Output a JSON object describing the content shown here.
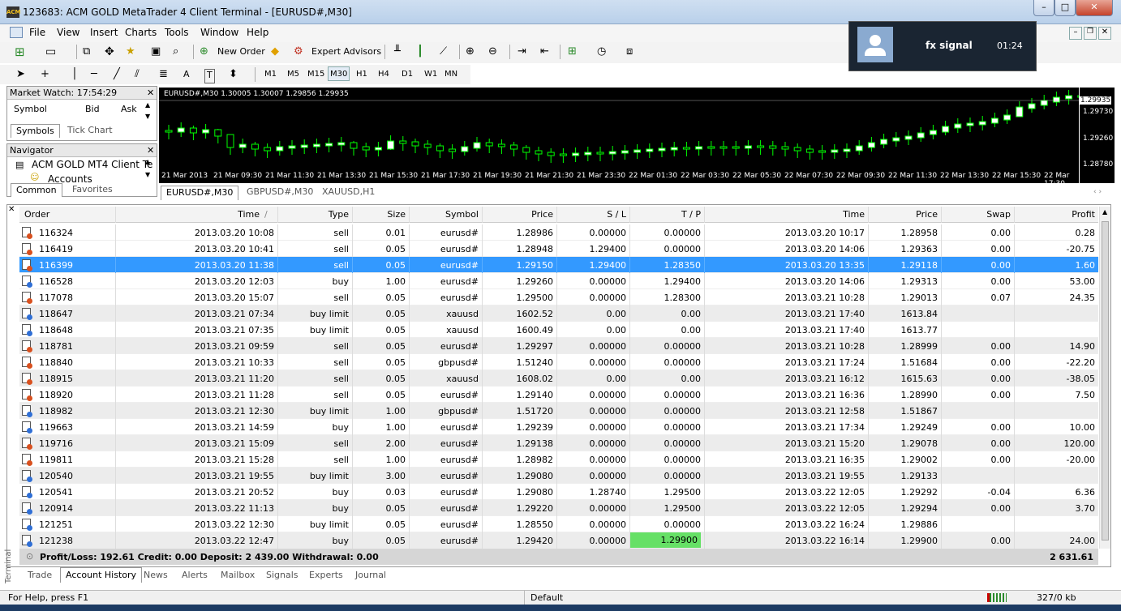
{
  "window": {
    "title": "123683: ACM GOLD MetaTrader 4 Client Terminal - [EURUSD#,M30]",
    "app_icon_text": "ACM"
  },
  "menu": [
    "File",
    "View",
    "Insert",
    "Charts",
    "Tools",
    "Window",
    "Help"
  ],
  "toolbar": {
    "new_order": "New Order",
    "expert_advisors": "Expert Advisors",
    "text_tool": "A",
    "textlabel_tool": "T"
  },
  "timeframes": [
    "M1",
    "M5",
    "M15",
    "M30",
    "H1",
    "H4",
    "D1",
    "W1",
    "MN"
  ],
  "market_watch": {
    "title": "Market Watch: 17:54:29",
    "col_symbol": "Symbol",
    "col_bid": "Bid",
    "col_ask": "Ask",
    "tab_symbols": "Symbols",
    "tab_tick_chart": "Tick Chart"
  },
  "navigator": {
    "title": "Navigator",
    "item_root": "ACM GOLD MT4 Client Te",
    "item_accounts": "Accounts",
    "tab_common": "Common",
    "tab_favorites": "Favorites"
  },
  "chart": {
    "header": "EURUSD#,M30  1.30005 1.30007 1.29856 1.29935",
    "price_labels": [
      "1.29935",
      "1.29730",
      "1.29260",
      "1.28780"
    ],
    "time_labels": [
      "21 Mar 2013",
      "21 Mar 09:30",
      "21 Mar 11:30",
      "21 Mar 13:30",
      "21 Mar 15:30",
      "21 Mar 17:30",
      "21 Mar 19:30",
      "21 Mar 21:30",
      "21 Mar 23:30",
      "22 Mar 01:30",
      "22 Mar 03:30",
      "22 Mar 05:30",
      "22 Mar 07:30",
      "22 Mar 09:30",
      "22 Mar 11:30",
      "22 Mar 13:30",
      "22 Mar 15:30",
      "22 Mar 17:30"
    ],
    "tabs": [
      "EURUSD#,M30",
      "GBPUSD#,M30",
      "XAUUSD,H1"
    ],
    "colors": {
      "bg": "#000000",
      "candle": "#00ff00",
      "bull_body": "#ffffff"
    }
  },
  "popup": {
    "title": "fx signal",
    "time": "01:24"
  },
  "terminal": {
    "columns": [
      "Order",
      "Time",
      "Type",
      "Size",
      "Symbol",
      "Price",
      "S / L",
      "T / P",
      "Time",
      "Price",
      "Swap",
      "Profit"
    ],
    "time_sort_mark": "/",
    "rows": [
      [
        "116324",
        "2013.03.20 10:08",
        "sell",
        "0.01",
        "eurusd#",
        "1.28986",
        "0.00000",
        "0.00000",
        "2013.03.20 10:17",
        "1.28958",
        "0.00",
        "0.28"
      ],
      [
        "116419",
        "2013.03.20 10:41",
        "sell",
        "0.05",
        "eurusd#",
        "1.28948",
        "1.29400",
        "0.00000",
        "2013.03.20 14:06",
        "1.29363",
        "0.00",
        "-20.75"
      ],
      [
        "116399",
        "2013.03.20 11:38",
        "sell",
        "0.05",
        "eurusd#",
        "1.29150",
        "1.29400",
        "1.28350",
        "2013.03.20 13:35",
        "1.29118",
        "0.00",
        "1.60"
      ],
      [
        "116528",
        "2013.03.20 12:03",
        "buy",
        "1.00",
        "eurusd#",
        "1.29260",
        "0.00000",
        "1.29400",
        "2013.03.20 14:06",
        "1.29313",
        "0.00",
        "53.00"
      ],
      [
        "117078",
        "2013.03.20 15:07",
        "sell",
        "0.05",
        "eurusd#",
        "1.29500",
        "0.00000",
        "1.28300",
        "2013.03.21 10:28",
        "1.29013",
        "0.07",
        "24.35"
      ],
      [
        "118647",
        "2013.03.21 07:34",
        "buy limit",
        "0.05",
        "xauusd",
        "1602.52",
        "0.00",
        "0.00",
        "2013.03.21 17:40",
        "1613.84",
        "",
        ""
      ],
      [
        "118648",
        "2013.03.21 07:35",
        "buy limit",
        "0.05",
        "xauusd",
        "1600.49",
        "0.00",
        "0.00",
        "2013.03.21 17:40",
        "1613.77",
        "",
        ""
      ],
      [
        "118781",
        "2013.03.21 09:59",
        "sell",
        "0.05",
        "eurusd#",
        "1.29297",
        "0.00000",
        "0.00000",
        "2013.03.21 10:28",
        "1.28999",
        "0.00",
        "14.90"
      ],
      [
        "118840",
        "2013.03.21 10:33",
        "sell",
        "0.05",
        "gbpusd#",
        "1.51240",
        "0.00000",
        "0.00000",
        "2013.03.21 17:24",
        "1.51684",
        "0.00",
        "-22.20"
      ],
      [
        "118915",
        "2013.03.21 11:20",
        "sell",
        "0.05",
        "xauusd",
        "1608.02",
        "0.00",
        "0.00",
        "2013.03.21 16:12",
        "1615.63",
        "0.00",
        "-38.05"
      ],
      [
        "118920",
        "2013.03.21 11:28",
        "sell",
        "0.05",
        "eurusd#",
        "1.29140",
        "0.00000",
        "0.00000",
        "2013.03.21 16:36",
        "1.28990",
        "0.00",
        "7.50"
      ],
      [
        "118982",
        "2013.03.21 12:30",
        "buy limit",
        "1.00",
        "gbpusd#",
        "1.51720",
        "0.00000",
        "0.00000",
        "2013.03.21 12:58",
        "1.51867",
        "",
        ""
      ],
      [
        "119663",
        "2013.03.21 14:59",
        "buy",
        "1.00",
        "eurusd#",
        "1.29239",
        "0.00000",
        "0.00000",
        "2013.03.21 17:34",
        "1.29249",
        "0.00",
        "10.00"
      ],
      [
        "119716",
        "2013.03.21 15:09",
        "sell",
        "2.00",
        "eurusd#",
        "1.29138",
        "0.00000",
        "0.00000",
        "2013.03.21 15:20",
        "1.29078",
        "0.00",
        "120.00"
      ],
      [
        "119811",
        "2013.03.21 15:28",
        "sell",
        "1.00",
        "eurusd#",
        "1.28982",
        "0.00000",
        "0.00000",
        "2013.03.21 16:35",
        "1.29002",
        "0.00",
        "-20.00"
      ],
      [
        "120540",
        "2013.03.21 19:55",
        "buy limit",
        "3.00",
        "eurusd#",
        "1.29080",
        "0.00000",
        "0.00000",
        "2013.03.21 19:55",
        "1.29133",
        "",
        ""
      ],
      [
        "120541",
        "2013.03.21 20:52",
        "buy",
        "0.03",
        "eurusd#",
        "1.29080",
        "1.28740",
        "1.29500",
        "2013.03.22 12:05",
        "1.29292",
        "-0.04",
        "6.36"
      ],
      [
        "120914",
        "2013.03.22 11:13",
        "buy",
        "0.05",
        "eurusd#",
        "1.29220",
        "0.00000",
        "1.29500",
        "2013.03.22 12:05",
        "1.29294",
        "0.00",
        "3.70"
      ],
      [
        "121251",
        "2013.03.22 12:30",
        "buy limit",
        "0.05",
        "eurusd#",
        "1.28550",
        "0.00000",
        "0.00000",
        "2013.03.22 16:24",
        "1.29886",
        "",
        ""
      ],
      [
        "121238",
        "2013.03.22 12:47",
        "buy",
        "0.05",
        "eurusd#",
        "1.29420",
        "0.00000",
        "1.29900",
        "2013.03.22 16:14",
        "1.29900",
        "0.00",
        "24.00"
      ]
    ],
    "selected_row": 2,
    "tp_hit_row": 19,
    "summary": "Profit/Loss: 192.61  Credit: 0.00  Deposit: 2 439.00  Withdrawal: 0.00",
    "summary_total": "2 631.61",
    "tabs": [
      "Trade",
      "Account History",
      "News",
      "Alerts",
      "Mailbox",
      "Signals",
      "Experts",
      "Journal"
    ],
    "side_label": "Terminal"
  },
  "status": {
    "help": "For Help, press F1",
    "profile": "Default",
    "traffic": "327/0 kb"
  }
}
